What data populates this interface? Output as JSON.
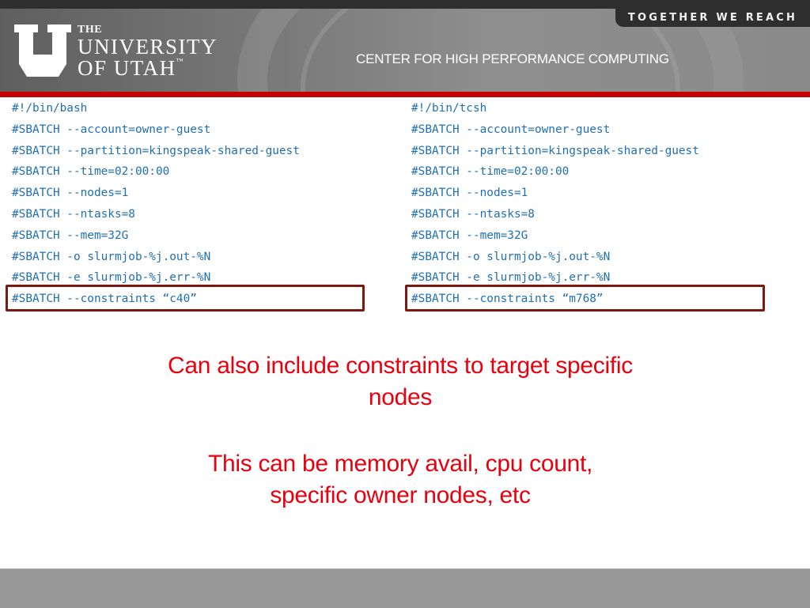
{
  "header": {
    "tagline": "TOGETHER WE REACH",
    "logo": {
      "line1": "THE",
      "line2": "UNIVERSITY",
      "line3": "OF UTAH",
      "trademark": "™"
    },
    "center_name": "CENTER FOR HIGH PERFORMANCE COMPUTING",
    "accent_color": "#c40000"
  },
  "scripts": {
    "left": {
      "lines": [
        "#!/bin/bash",
        "#SBATCH --account=owner-guest",
        "#SBATCH --partition=kingspeak-shared-guest",
        "#SBATCH --time=02:00:00",
        "#SBATCH --nodes=1",
        "#SBATCH --ntasks=8",
        "#SBATCH --mem=32G",
        "#SBATCH -o slurmjob-%j.out-%N",
        "#SBATCH -e slurmjob-%j.err-%N",
        "#SBATCH --constraints “c40”"
      ],
      "highlighted_line_index": 9
    },
    "right": {
      "lines": [
        "#!/bin/tcsh",
        "#SBATCH --account=owner-guest",
        "#SBATCH --partition=kingspeak-shared-guest",
        "#SBATCH --time=02:00:00",
        "#SBATCH --nodes=1",
        "#SBATCH --ntasks=8",
        "#SBATCH --mem=32G",
        "#SBATCH -o slurmjob-%j.out-%N",
        "#SBATCH -e slurmjob-%j.err-%N",
        "#SBATCH --constraints “m768”"
      ],
      "highlighted_line_index": 9
    }
  },
  "notes": {
    "note1_line1": "Can also include constraints to target specific",
    "note1_line2": "nodes",
    "note2_line1": "This can be memory avail, cpu count,",
    "note2_line2": "specific owner nodes, etc",
    "color": "#e8000e"
  }
}
